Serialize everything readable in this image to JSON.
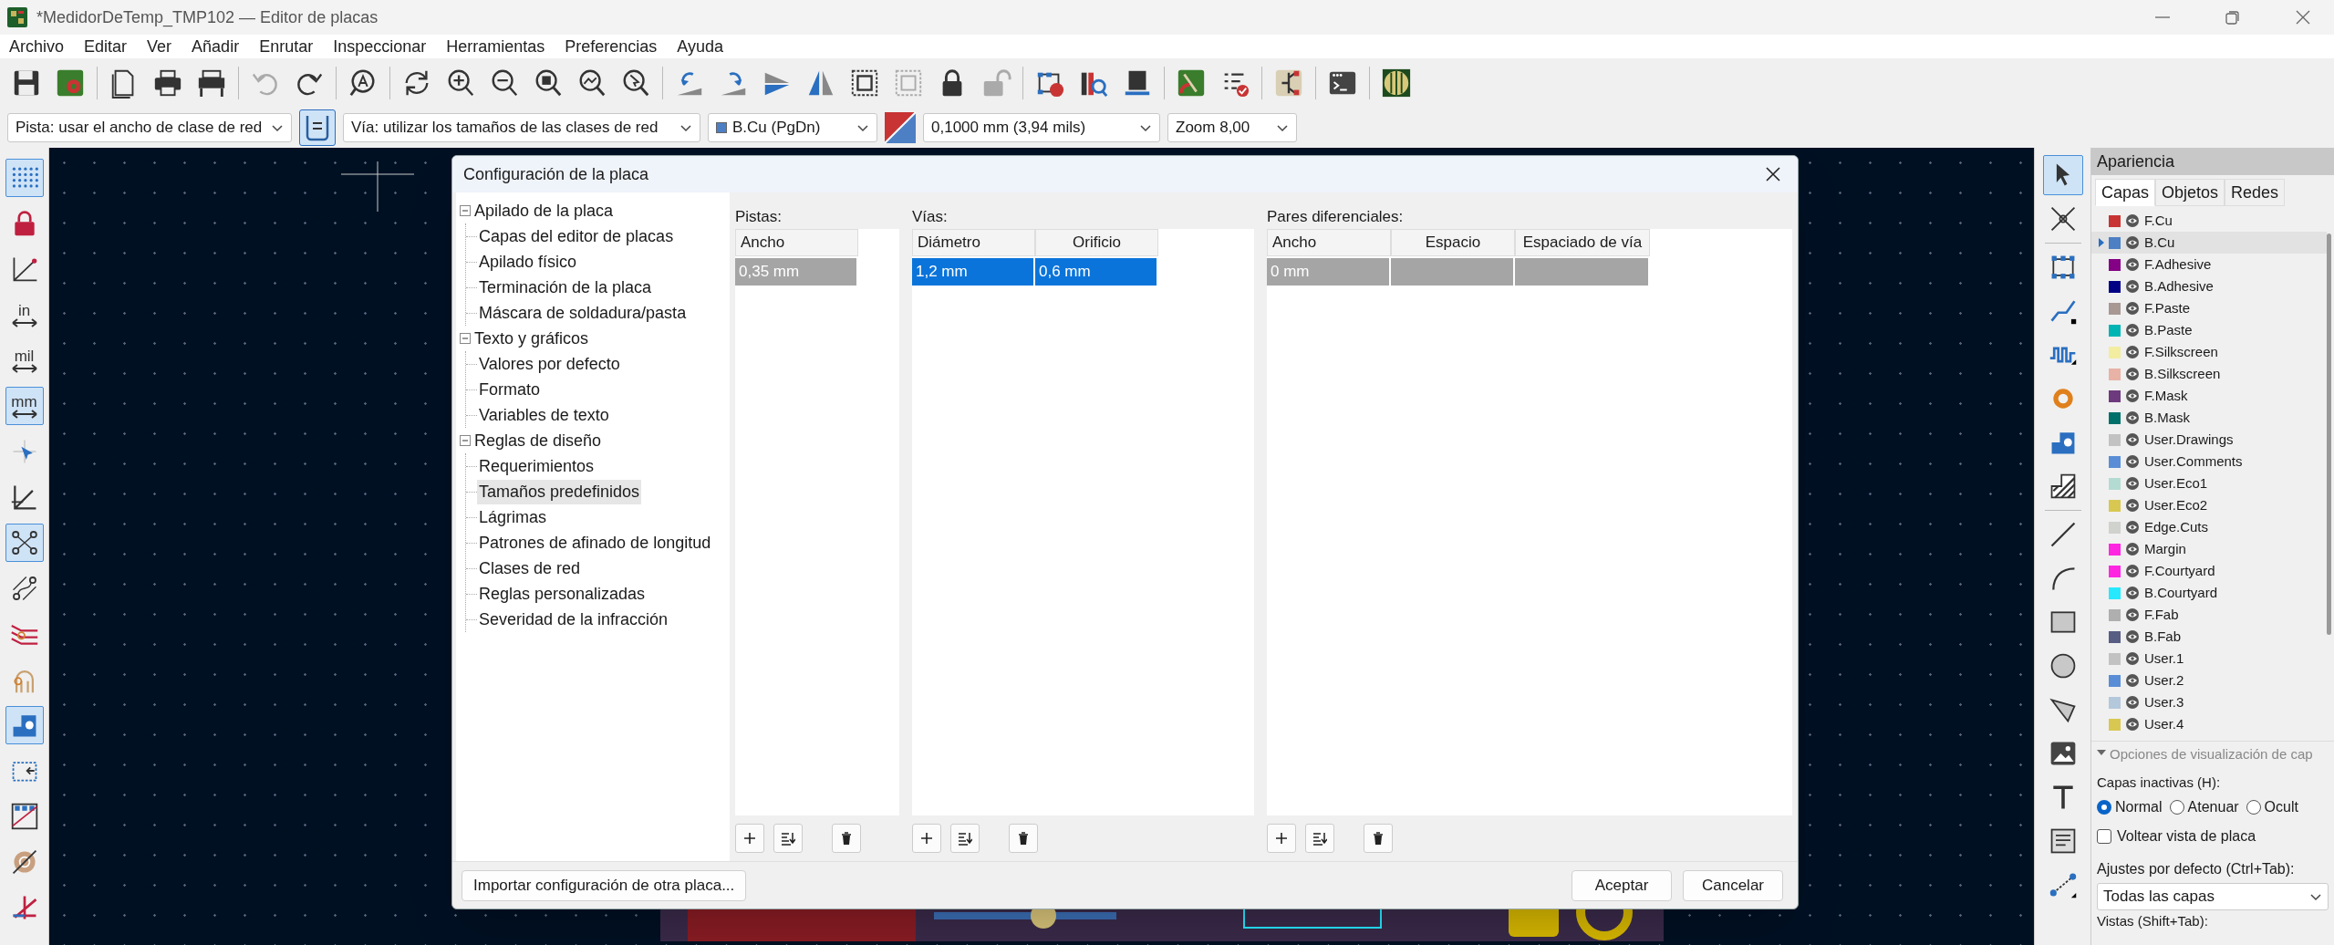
{
  "window": {
    "title": "*MedidorDeTemp_TMP102 — Editor de placas"
  },
  "menu": [
    "Archivo",
    "Editar",
    "Ver",
    "Añadir",
    "Enrutar",
    "Inspeccionar",
    "Herramientas",
    "Preferencias",
    "Ayuda"
  ],
  "toolbar": {
    "track_width": "Pista: usar el ancho de clase de red",
    "auto_width_on": true,
    "via_size": "Vía: utilizar los tamaños de las clases de red",
    "layer": {
      "label": "B.Cu (PgDn)",
      "color": "#4d7fc4"
    },
    "grid": "0,1000 mm (3,94 mils)",
    "zoom": "Zoom 8,00"
  },
  "left_toolbar": [
    {
      "kind": "icon",
      "on": true
    },
    {
      "kind": "icon",
      "on": false
    },
    {
      "kind": "icon",
      "on": false
    },
    {
      "kind": "unit",
      "label": "in",
      "on": false
    },
    {
      "kind": "unit",
      "label": "mil",
      "on": false
    },
    {
      "kind": "unit",
      "label": "mm",
      "on": true
    },
    {
      "kind": "icon",
      "on": false
    },
    {
      "kind": "icon",
      "on": false
    },
    {
      "kind": "icon",
      "on": true
    },
    {
      "kind": "icon",
      "on": false
    },
    {
      "kind": "icon",
      "on": false
    },
    {
      "kind": "icon",
      "on": false
    },
    {
      "kind": "icon",
      "on": true
    },
    {
      "kind": "icon",
      "on": false
    },
    {
      "kind": "icon",
      "on": false
    },
    {
      "kind": "icon",
      "on": false
    },
    {
      "kind": "icon",
      "on": false
    }
  ],
  "dialog": {
    "title": "Configuración de la placa",
    "tree": [
      {
        "label": "Apilado de la placa",
        "expanded": true,
        "children": [
          {
            "label": "Capas del editor de placas",
            "selected": false
          },
          {
            "label": "Apilado físico",
            "selected": false
          },
          {
            "label": "Terminación de la placa",
            "selected": false
          },
          {
            "label": "Máscara de soldadura/pasta",
            "selected": false
          }
        ]
      },
      {
        "label": "Texto y gráficos",
        "expanded": true,
        "children": [
          {
            "label": "Valores por defecto",
            "selected": false
          },
          {
            "label": "Formato",
            "selected": false
          },
          {
            "label": "Variables de texto",
            "selected": false
          }
        ]
      },
      {
        "label": "Reglas de diseño",
        "expanded": true,
        "children": [
          {
            "label": "Requerimientos",
            "selected": false
          },
          {
            "label": "Tamaños predefinidos",
            "selected": true
          },
          {
            "label": "Lágrimas",
            "selected": false
          },
          {
            "label": "Patrones de afinado de longitud",
            "selected": false
          },
          {
            "label": "Clases de red",
            "selected": false
          },
          {
            "label": "Reglas personalizadas",
            "selected": false
          },
          {
            "label": "Severidad de la infracción",
            "selected": false
          }
        ]
      }
    ],
    "tables": [
      {
        "label": "Pistas:",
        "columns": [
          "Ancho"
        ],
        "rows": [
          {
            "cells": [
              "0,35 mm"
            ],
            "selected": false
          }
        ]
      },
      {
        "label": "Vías:",
        "columns": [
          "Diámetro",
          "Orificio"
        ],
        "rows": [
          {
            "cells": [
              "1,2 mm",
              "0,6 mm"
            ],
            "selected": true
          }
        ]
      },
      {
        "label": "Pares diferenciales:",
        "columns": [
          "Ancho",
          "Espacio",
          "Espaciado de vía"
        ],
        "rows": [
          {
            "cells": [
              "0 mm"
            ],
            "selected": false
          }
        ]
      }
    ],
    "import_button": "Importar configuración de otra placa...",
    "buttons": [
      "Aceptar",
      "Cancelar"
    ]
  },
  "right_toolbar": [
    {
      "selected": true
    },
    {
      "selected": false
    },
    {
      "selected": false
    },
    {
      "selected": false
    },
    {
      "selected": false
    },
    {
      "selected": false
    },
    {
      "selected": false
    },
    {
      "selected": false
    },
    {
      "selected": false
    },
    {
      "selected": false
    },
    {
      "selected": false
    },
    {
      "selected": false
    },
    {
      "selected": false
    },
    {
      "selected": false
    },
    {
      "selected": false
    },
    {
      "selected": false
    },
    {
      "selected": false
    }
  ],
  "appearance": {
    "title": "Apariencia",
    "tabs": [
      {
        "label": "Capas",
        "selected": true
      },
      {
        "label": "Objetos",
        "selected": false
      },
      {
        "label": "Redes",
        "selected": false
      }
    ],
    "layers": [
      {
        "name": "F.Cu",
        "color": "#c83434",
        "visible": true,
        "selected": false
      },
      {
        "name": "B.Cu",
        "color": "#4d7fc4",
        "visible": true,
        "selected": true
      },
      {
        "name": "F.Adhesive",
        "color": "#840084",
        "visible": true,
        "selected": false
      },
      {
        "name": "B.Adhesive",
        "color": "#000084",
        "visible": true,
        "selected": false
      },
      {
        "name": "F.Paste",
        "color": "#a89894",
        "visible": true,
        "selected": false
      },
      {
        "name": "B.Paste",
        "color": "#00b4b4",
        "visible": true,
        "selected": false
      },
      {
        "name": "F.Silkscreen",
        "color": "#f2eda1",
        "visible": true,
        "selected": false
      },
      {
        "name": "B.Silkscreen",
        "color": "#e8b2a7",
        "visible": true,
        "selected": false
      },
      {
        "name": "F.Mask",
        "color": "#6e3a7e",
        "visible": true,
        "selected": false
      },
      {
        "name": "B.Mask",
        "color": "#02706a",
        "visible": true,
        "selected": false
      },
      {
        "name": "User.Drawings",
        "color": "#c2c2c2",
        "visible": true,
        "selected": false
      },
      {
        "name": "User.Comments",
        "color": "#598ed6",
        "visible": true,
        "selected": false
      },
      {
        "name": "User.Eco1",
        "color": "#b4dbd2",
        "visible": true,
        "selected": false
      },
      {
        "name": "User.Eco2",
        "color": "#d8c852",
        "visible": true,
        "selected": false
      },
      {
        "name": "Edge.Cuts",
        "color": "#d0d2cd",
        "visible": true,
        "selected": false
      },
      {
        "name": "Margin",
        "color": "#ff26e2",
        "visible": true,
        "selected": false
      },
      {
        "name": "F.Courtyard",
        "color": "#ff26e2",
        "visible": true,
        "selected": false
      },
      {
        "name": "B.Courtyard",
        "color": "#26e9ff",
        "visible": true,
        "selected": false
      },
      {
        "name": "F.Fab",
        "color": "#afafaf",
        "visible": true,
        "selected": false
      },
      {
        "name": "B.Fab",
        "color": "#585d84",
        "visible": true,
        "selected": false
      },
      {
        "name": "User.1",
        "color": "#c2c2c2",
        "visible": true,
        "selected": false
      },
      {
        "name": "User.2",
        "color": "#598ed6",
        "visible": true,
        "selected": false
      },
      {
        "name": "User.3",
        "color": "#b4c8dc",
        "visible": true,
        "selected": false
      },
      {
        "name": "User.4",
        "color": "#d8c852",
        "visible": true,
        "selected": false
      }
    ],
    "options": {
      "title": "Opciones de visualización de cap",
      "expanded": true,
      "inactive_label": "Capas inactivas (H):",
      "radios": [
        {
          "label": "Normal",
          "selected": true
        },
        {
          "label": "Atenuar",
          "selected": false
        },
        {
          "label": "Ocult",
          "selected": false
        }
      ],
      "flip": {
        "label": "Voltear vista de placa",
        "checked": false
      }
    },
    "presets_label": "Ajustes por defecto (Ctrl+Tab):",
    "preset": "Todas las capas",
    "views_label": "Vistas (Shift+Tab):"
  }
}
